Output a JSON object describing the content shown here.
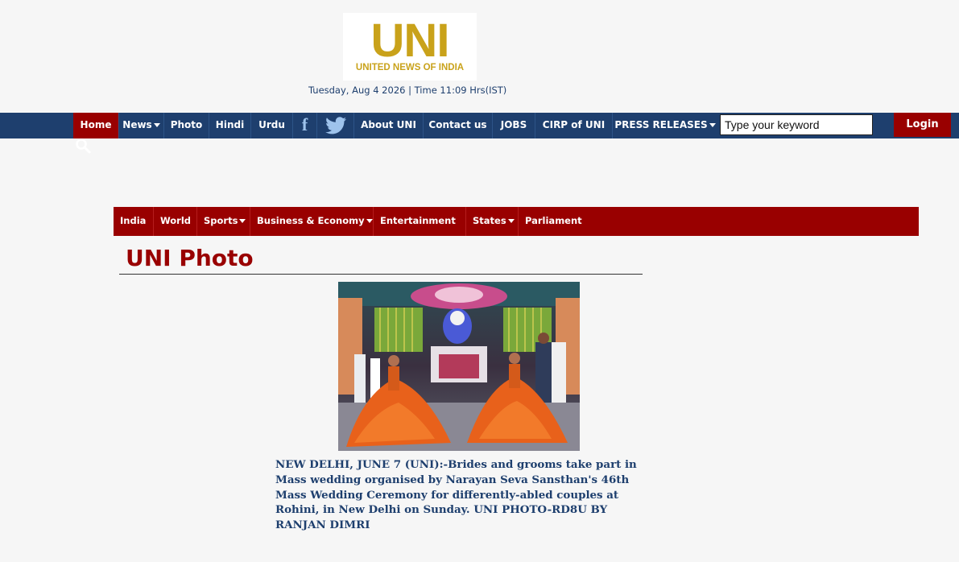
{
  "logo": {
    "big_text": "UNI",
    "small_text": "UNITED NEWS OF INDIA"
  },
  "header": {
    "date_time": "Tuesday, Aug 4 2026 | Time 11:09 Hrs(IST)"
  },
  "topnav": {
    "home": "Home",
    "news": "News",
    "photo": "Photo",
    "hindi": "Hindi",
    "urdu": "Urdu",
    "facebook": "f",
    "about": "About UNI",
    "contact": "Contact us",
    "jobs": "JOBS",
    "cirp": "CIRP of UNI",
    "press": "PRESS RELEASES",
    "search_placeholder": "Type your keyword",
    "login": "Login"
  },
  "catnav": {
    "india": "India",
    "world": "World",
    "sports": "Sports",
    "business": "Business & Economy",
    "entertainment": "Entertainment",
    "states": "States",
    "parliament": "Parliament"
  },
  "main": {
    "title": "UNI Photo",
    "caption": "NEW DELHI, JUNE 7 (UNI):-Brides and grooms take part in Mass wedding organised by Narayan Seva Sansthan's 46th Mass Wedding Ceremony for differently-abled couples at Rohini, in New Delhi on Sunday. UNI PHOTO-RD8U BY RANJAN DIMRI"
  },
  "colors": {
    "navy": "#1e3f6e",
    "red": "#990000",
    "gold": "#c9a21a",
    "page_bg": "#f6f6f6"
  }
}
